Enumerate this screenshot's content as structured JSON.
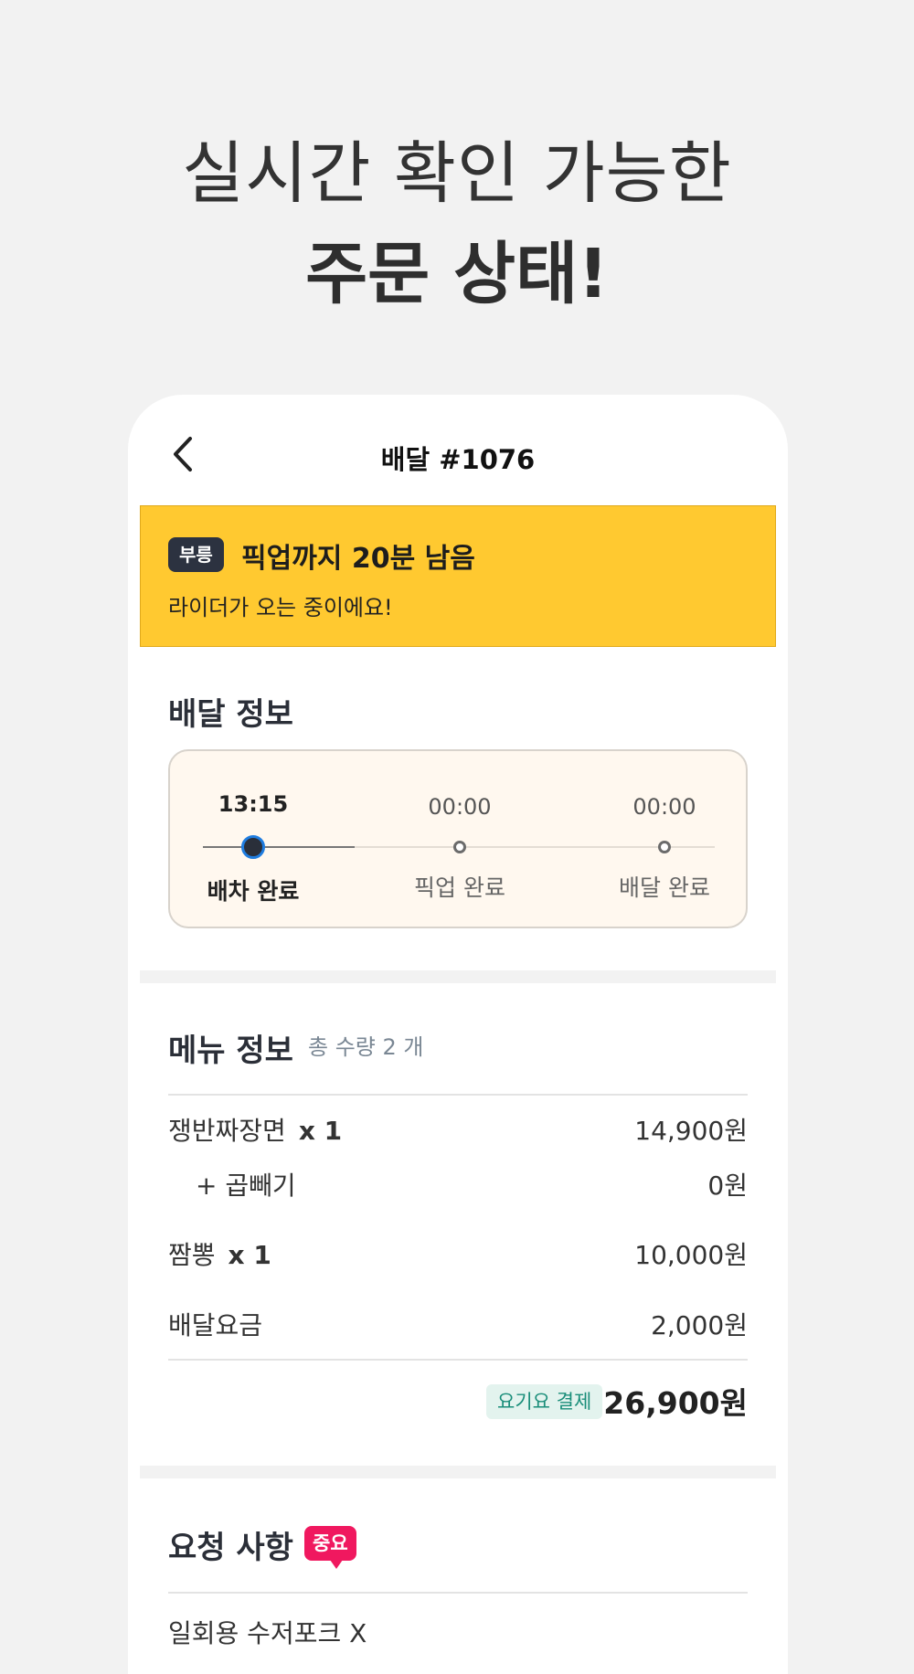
{
  "headline": {
    "line1": "실시간 확인 가능한",
    "line2": "주문 상태!"
  },
  "topbar": {
    "title": "배달 #1076",
    "back_icon": "chevron-left-icon"
  },
  "banner": {
    "chip": "부릉",
    "title": "픽업까지 20분 남음",
    "subtitle": "라이더가 오는 중이에요!",
    "color": "#ffc930"
  },
  "delivery_info": {
    "title": "배달 정보",
    "steps": [
      {
        "time": "13:15",
        "label": "배차 완료",
        "active": true
      },
      {
        "time": "00:00",
        "label": "픽업 완료",
        "active": false
      },
      {
        "time": "00:00",
        "label": "배달 완료",
        "active": false
      }
    ]
  },
  "menu_info": {
    "title": "메뉴 정보",
    "count_label": "총 수량 2 개",
    "items": [
      {
        "name": "쟁반짜장면",
        "qty": "x 1",
        "price": "14,900원"
      },
      {
        "name": "+ 곱빼기",
        "qty": "",
        "price": "0원"
      },
      {
        "name": "짬뽕",
        "qty": "x 1",
        "price": "10,000원"
      },
      {
        "name": "배달요금",
        "qty": "",
        "price": "2,000원"
      }
    ],
    "payment_chip": "요기요 결제",
    "total": "26,900원"
  },
  "request": {
    "title": "요청 사항",
    "badge": "중요",
    "first_line": "일회용 수저포크 X"
  },
  "colors": {
    "accent_yellow": "#ffc930",
    "important_pink": "#f0185f",
    "pay_green": "#1a8e7a",
    "active_dot_ring": "#1f7de0"
  }
}
